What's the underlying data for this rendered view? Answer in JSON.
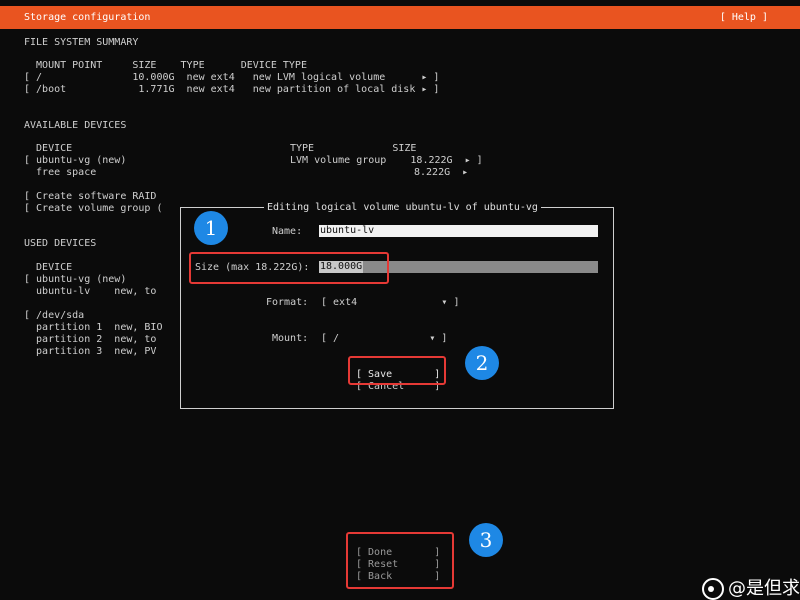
{
  "header": {
    "title": "Storage configuration",
    "help": "[ Help ]",
    "accent_color": "#e95420"
  },
  "fs_summary": {
    "heading": "FILE SYSTEM SUMMARY",
    "columns": "  MOUNT POINT     SIZE    TYPE      DEVICE TYPE",
    "rows": [
      "[ /               10.000G  new ext4   new LVM logical volume      ▸ ]",
      "[ /boot            1.771G  new ext4   new partition of local disk ▸ ]"
    ]
  },
  "available": {
    "heading": "AVAILABLE DEVICES",
    "col_device": "  DEVICE",
    "col_type_size": "TYPE             SIZE",
    "row1_device": "[ ubuntu-vg (new)",
    "row1_type_size": "LVM volume group    18.222G  ▸ ]",
    "row2_device": "  free space",
    "row2_size": "8.222G  ▸",
    "raid": "[ Create software RAID",
    "vg": "[ Create volume group ("
  },
  "used": {
    "heading": "USED DEVICES",
    "lines": [
      "  DEVICE",
      "[ ubuntu-vg (new)",
      "  ubuntu-lv    new, to",
      "",
      "[ /dev/sda",
      "  partition 1  new, BIO",
      "  partition 2  new, to",
      "  partition 3  new, PV"
    ]
  },
  "dialog": {
    "title": "Editing logical volume ubuntu-lv of ubuntu-vg",
    "name_label": "Name:",
    "name_value": "ubuntu-lv",
    "size_label": "Size (max 18.222G):",
    "size_value": "18.000G",
    "format_label": "Format:",
    "format_value": "[ ext4              ▾ ]",
    "mount_label": "Mount:",
    "mount_value": "[ /               ▾ ]",
    "save": "[ Save       ]",
    "cancel": "[ Cancel     ]"
  },
  "footer": {
    "done": "[ Done       ]",
    "reset": "[ Reset      ]",
    "back": "[ Back       ]"
  },
  "annotations": {
    "badge1": "1",
    "badge2": "2",
    "badge3": "3",
    "highlight_color": "#e53935",
    "badge_color": "#1e88e5"
  },
  "watermark": {
    "text": "@是但求"
  }
}
